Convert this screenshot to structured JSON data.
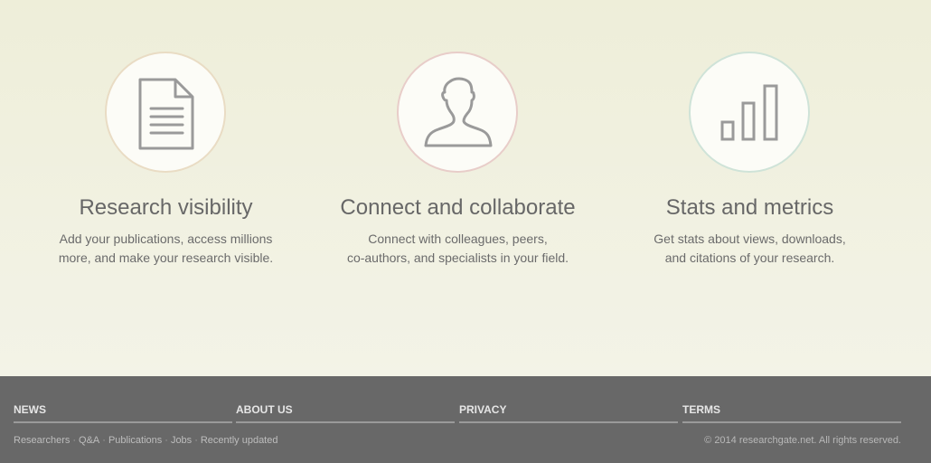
{
  "features": [
    {
      "icon": "document-icon",
      "title": "Research visibility",
      "desc_line1": "Add your publications, access millions",
      "desc_line2": "more, and make your research visible.",
      "ring_color": "#e9dcc4"
    },
    {
      "icon": "person-icon",
      "title": "Connect and collaborate",
      "desc_line1": "Connect with colleagues, peers,",
      "desc_line2": "co-authors, and specialists in your field.",
      "ring_color": "#e8cdc9"
    },
    {
      "icon": "bar-chart-icon",
      "title": "Stats and metrics",
      "desc_line1": "Get stats about views, downloads,",
      "desc_line2": "and citations of your research.",
      "ring_color": "#cfe3d8"
    }
  ],
  "footer": {
    "headings": [
      "NEWS",
      "ABOUT US",
      "PRIVACY",
      "TERMS"
    ],
    "links": [
      "Researchers",
      "Q&A",
      "Publications",
      "Jobs",
      "Recently updated"
    ],
    "separator": "·",
    "copyright": "© 2014 researchgate.net. All rights reserved."
  },
  "colors": {
    "footer_bg": "#686868",
    "hero_bg": "#f0f0df",
    "icon_gray": "#999999"
  }
}
